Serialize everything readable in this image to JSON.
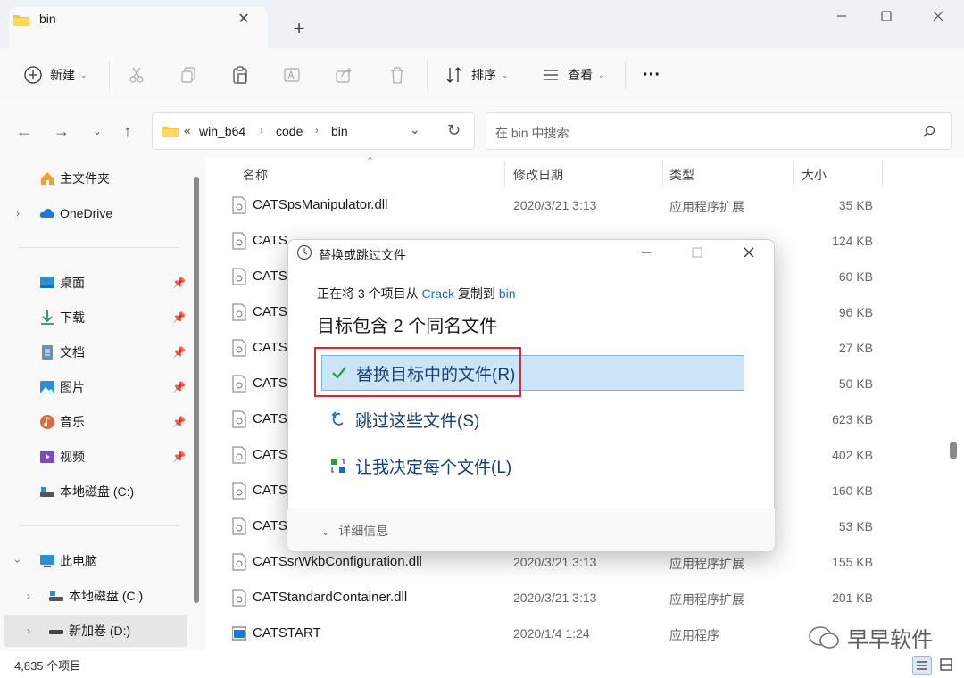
{
  "window": {
    "tab_title": "bin",
    "new_tab_symbol": "+",
    "close_tab_symbol": "✕"
  },
  "toolbar": {
    "new_label": "新建",
    "sort_label": "排序",
    "view_label": "查看",
    "more_label": "···"
  },
  "address": {
    "overflow": "«",
    "crumbs": [
      "win_b64",
      "code",
      "bin"
    ],
    "search_placeholder": "在 bin 中搜索"
  },
  "sidebar": {
    "home": "主文件夹",
    "onedrive": "OneDrive",
    "desktop": "桌面",
    "downloads": "下载",
    "documents": "文档",
    "pictures": "图片",
    "music": "音乐",
    "videos": "视频",
    "local_c": "本地磁盘 (C:)",
    "this_pc": "此电脑",
    "pc_local_c": "本地磁盘 (C:)",
    "new_volume": "新加卷 (D:)"
  },
  "columns": {
    "name": "名称",
    "date": "修改日期",
    "type": "类型",
    "size": "大小"
  },
  "files": [
    {
      "name": "CATSpsManipulator.dll",
      "date": "2020/3/21 3:13",
      "type": "应用程序扩展",
      "size": "35 KB"
    },
    {
      "name": "CATS",
      "date": "",
      "type": "",
      "size": "124 KB"
    },
    {
      "name": "CATS",
      "date": "",
      "type": "",
      "size": "60 KB"
    },
    {
      "name": "CATS",
      "date": "",
      "type": "",
      "size": "96 KB"
    },
    {
      "name": "CATS",
      "date": "",
      "type": "",
      "size": "27 KB"
    },
    {
      "name": "CATS",
      "date": "",
      "type": "",
      "size": "50 KB"
    },
    {
      "name": "CATS",
      "date": "",
      "type": "",
      "size": "623 KB"
    },
    {
      "name": "CATS",
      "date": "",
      "type": "",
      "size": "402 KB"
    },
    {
      "name": "CATS",
      "date": "",
      "type": "",
      "size": "160 KB"
    },
    {
      "name": "CATS",
      "date": "",
      "type": "",
      "size": "53 KB"
    },
    {
      "name": "CATSsrWkbConfiguration.dll",
      "date": "2020/3/21 3:13",
      "type": "应用程序扩展",
      "size": "155 KB"
    },
    {
      "name": "CATStandardContainer.dll",
      "date": "2020/3/21 3:13",
      "type": "应用程序扩展",
      "size": "201 KB"
    },
    {
      "name": "CATSTART",
      "date": "2020/1/4 1:24",
      "type": "应用程序",
      "size": ""
    }
  ],
  "status": {
    "count": "4,835 个项目"
  },
  "dialog": {
    "title": "替换或跳过文件",
    "line1_prefix": "正在将 3 个项目从 ",
    "line1_src": "Crack",
    "line1_mid": " 复制到 ",
    "line1_dst": "bin",
    "heading": "目标包含 2 个同名文件",
    "option_replace": "替换目标中的文件(R)",
    "option_skip": "跳过这些文件(S)",
    "option_decide": "让我决定每个文件(L)",
    "details": "详细信息"
  },
  "watermark": {
    "text": "早早软件"
  },
  "colors": {
    "accent": "#1f6bb8",
    "highlight": "#cce4f7",
    "annotation_red": "#e2262b"
  }
}
